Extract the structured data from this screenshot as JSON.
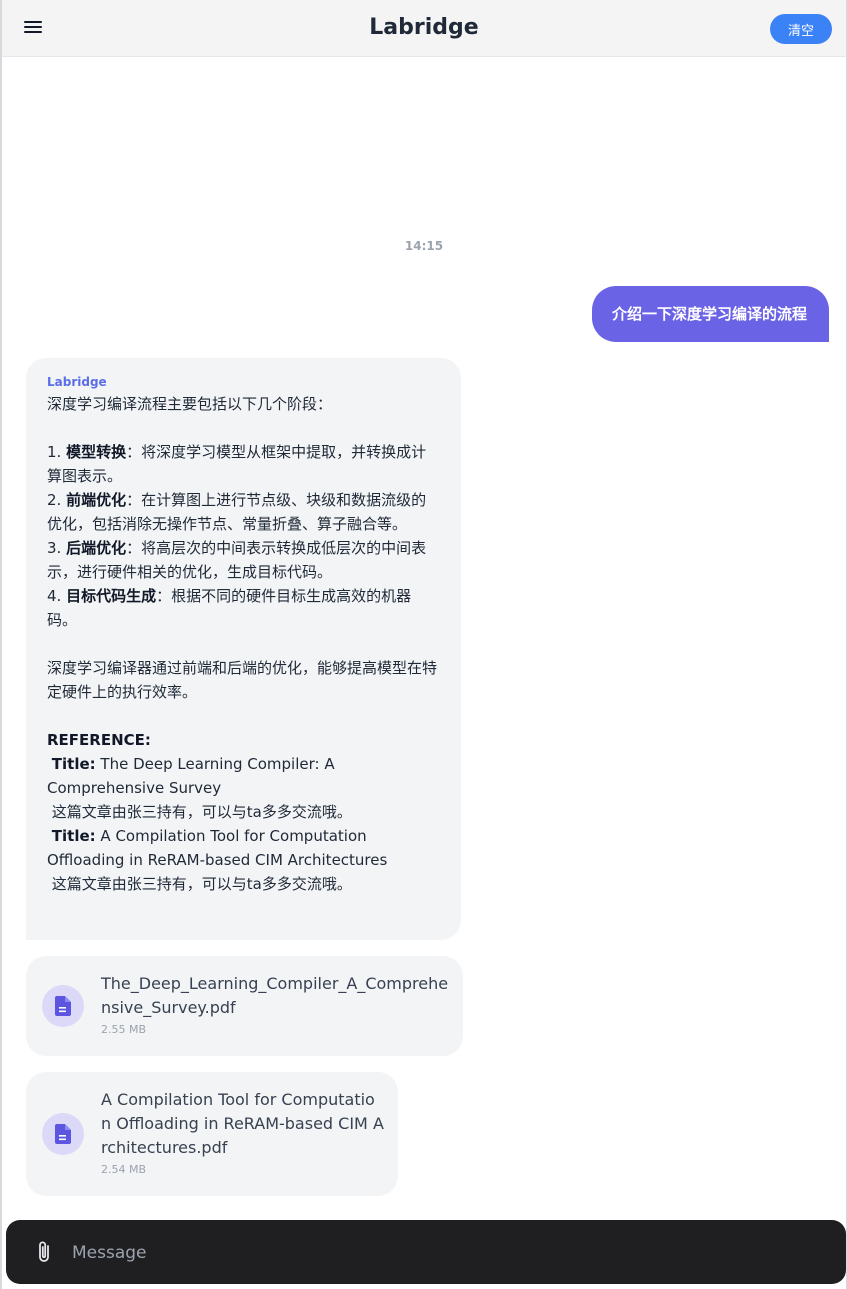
{
  "header": {
    "title": "Labridge",
    "clear_label": "清空"
  },
  "conversation": {
    "timestamp": "14:15",
    "user_message": "介绍一下深度学习编译的流程",
    "bot": {
      "name": "Labridge",
      "intro": "深度学习编译流程主要包括以下几个阶段：",
      "steps": [
        {
          "num": "1. ",
          "title": "模型转换",
          "text": "：将深度学习模型从框架中提取，并转换成计算图表示。"
        },
        {
          "num": "2. ",
          "title": "前端优化",
          "text": "：在计算图上进行节点级、块级和数据流级的优化，包括消除无操作节点、常量折叠、算子融合等。"
        },
        {
          "num": "3. ",
          "title": "后端优化",
          "text": "：将高层次的中间表示转换成低层次的中间表示，进行硬件相关的优化，生成目标代码。"
        },
        {
          "num": "4. ",
          "title": "目标代码生成",
          "text": "：根据不同的硬件目标生成高效的机器码。"
        }
      ],
      "summary": "深度学习编译器通过前端和后端的优化，能够提高模型在特定硬件上的执行效率。",
      "reference_label": "REFERENCE:",
      "references": [
        {
          "title_label": "Title:",
          "title": " The Deep Learning Compiler: A Comprehensive Survey",
          "owner": "这篇文章由张三持有，可以与ta多多交流哦。"
        },
        {
          "title_label": "Title:",
          "title": " A Compilation Tool for Computation Offloading in ReRAM-based CIM Architectures",
          "owner": "这篇文章由张三持有，可以与ta多多交流哦。"
        }
      ]
    },
    "files": [
      {
        "name": "The_Deep_Learning_Compiler_A_Comprehensive_Survey.pdf",
        "size": "2.55 MB",
        "icon": "document-icon"
      },
      {
        "name": "A Compilation Tool for Computation Offloading in ReRAM-based CIM Architectures.pdf",
        "size": "2.54 MB",
        "icon": "document-icon"
      }
    ]
  },
  "input": {
    "placeholder": "Message",
    "value": "",
    "attach_icon": "paperclip-icon"
  },
  "colors": {
    "accent": "#3b82f6",
    "user_bubble": "#6b63e6",
    "bot_name": "#5b6ee8",
    "input_bar": "#1f1f22"
  }
}
